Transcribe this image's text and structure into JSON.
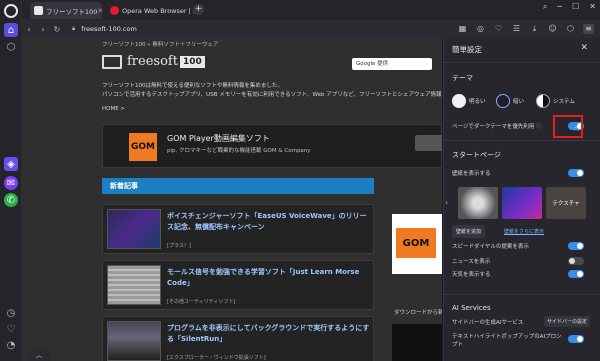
{
  "tabs": [
    {
      "title": "フリーソフト100",
      "active": true
    },
    {
      "title": "Opera Web Browser | Fast",
      "active": false
    }
  ],
  "address": {
    "url": "freesoft-100.com"
  },
  "page": {
    "breadcrumb": "フリーソフト100 » 無料ソフト＋フリーウェア",
    "logo_name": "freesoft",
    "logo_num": "100",
    "search_label": "Google 提供",
    "intro_1": "フリーソフト100は無料で使える便利なソフトや無料情報を集めました。",
    "intro_2": "パソコンで活用するデスクトップアプリ、USB メモリーを有効に利用できるソフト、Web アプリなど、フリーソフトとシェアウェア情報を紹介しています。",
    "home_link": "HOME >",
    "ad": {
      "logo": "GOM",
      "title": "GOM Player動画編集ソフト",
      "subtitle": "pip, クロマキーなど職業的な機能搭載 GOM & Company"
    },
    "news_header": "新着記事",
    "articles": [
      {
        "title": "ポイスチェンジャーソフト「EaseUS VoiceWave」のリリース記念、無償配布キャンペーン",
        "tag": "[プラス！]"
      },
      {
        "title": "モールス信号を勉強できる学習ソフト「Just Learn Morse Code」",
        "tag": "[その他ユーティリティソフト]"
      },
      {
        "title": "プログラムを非表示にしてバックグラウンドで実行するようにする「SilentRun」",
        "tag": "[エクスプローラー・ウィンドウ拡張ソフト]"
      }
    ],
    "right_ad_logo": "GOM",
    "download_label": "ダウンロードから新の機能"
  },
  "panel": {
    "title": "簡単設定",
    "theme_header": "テーマ",
    "theme_options": [
      "明るい",
      "暗い",
      "システム"
    ],
    "dark_pages_label": "ページでダークテーマを優先利用",
    "dark_pages_on": true,
    "startpage_header": "スタートページ",
    "wallpaper_label": "壁紙を表示する",
    "wallpaper_on": true,
    "wallpaper_text": "テクスチャ",
    "add_wallpaper": "壁紙を追加",
    "more_wallpapers": "壁紙をさらに表示",
    "speeddial_label": "スピードダイヤルの提案を表示",
    "speeddial_on": true,
    "news_label": "ニュースを表示",
    "news_on": false,
    "weather_label": "天気を表示する",
    "weather_on": true,
    "ai_header": "AI Services",
    "ai_sidebar_label": "サイドバーの生成AIサービス",
    "ai_settings_btn": "サイドバーの設定",
    "ai_popup_label": "テキストハイライトポップアップのAIプロンプト",
    "ai_popup_on": true
  }
}
